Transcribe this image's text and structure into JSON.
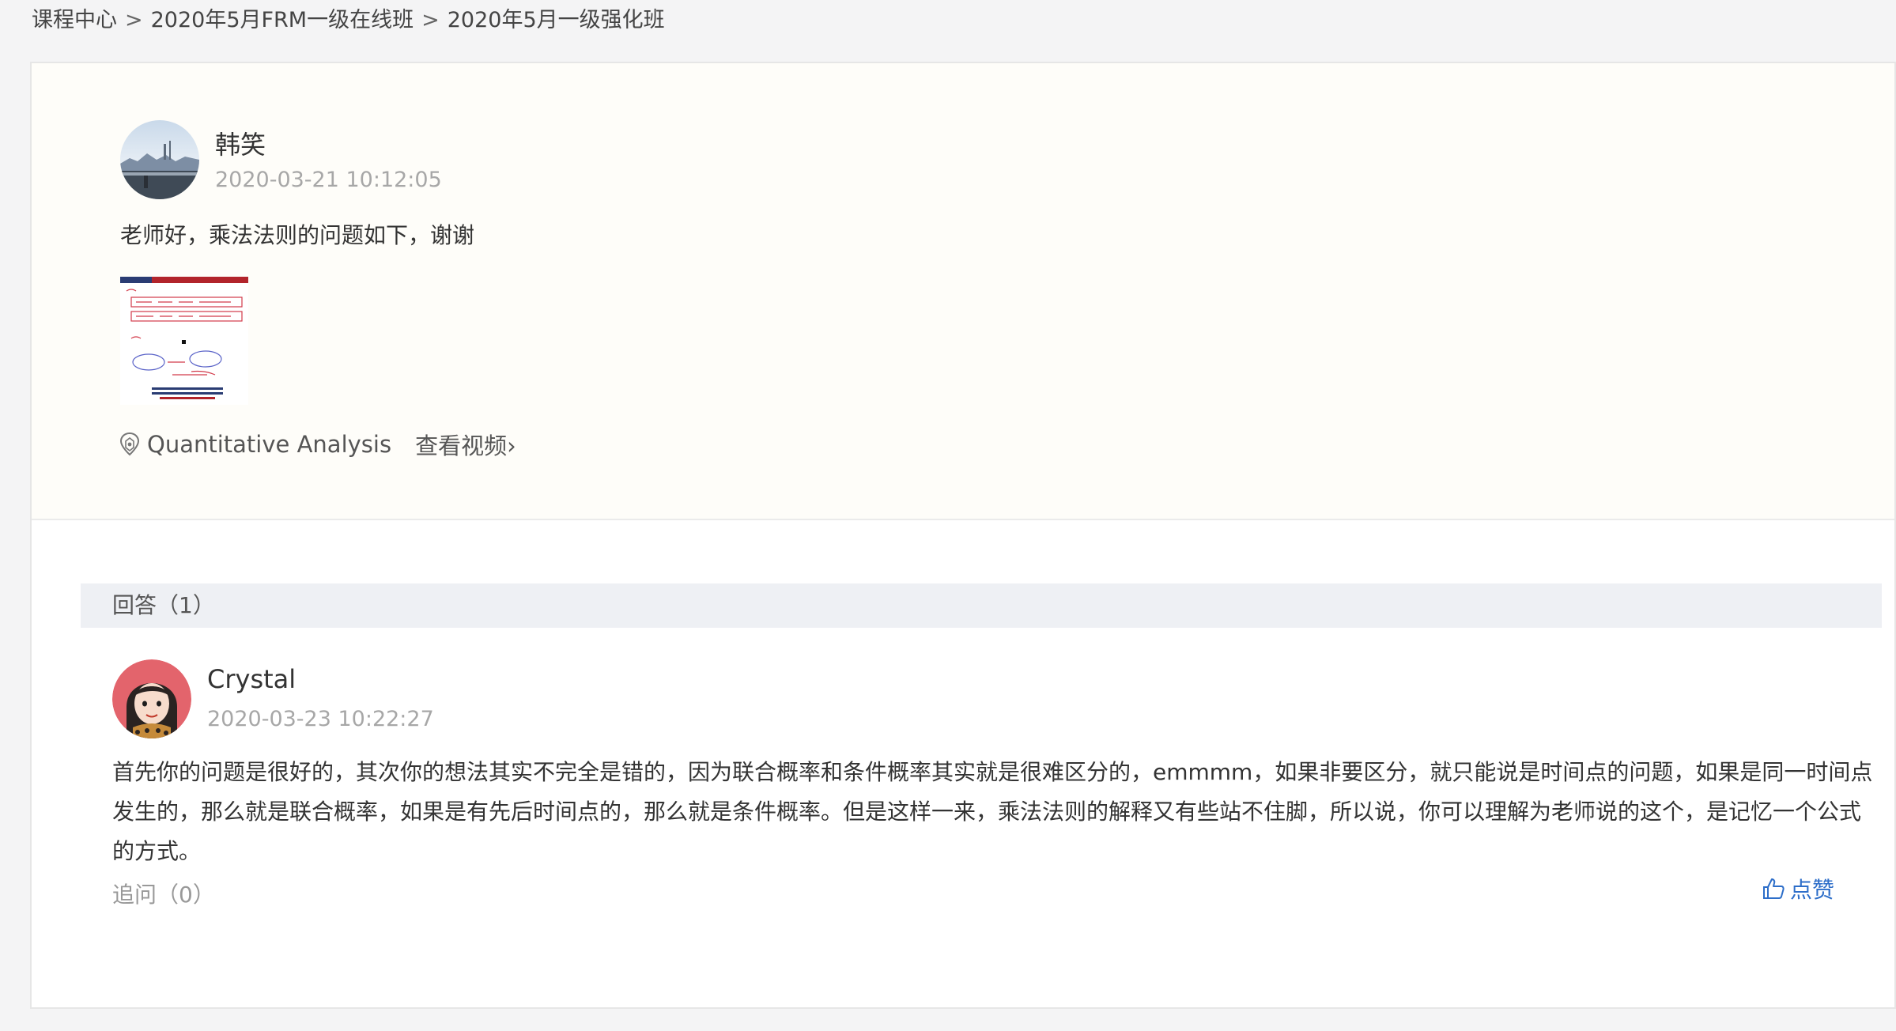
{
  "breadcrumb": {
    "items": [
      "课程中心",
      "2020年5月FRM一级在线班",
      "2020年5月一级强化班"
    ],
    "separator": ">"
  },
  "question": {
    "author": "韩笑",
    "time": "2020-03-21 10:12:05",
    "content": "老师好，乘法法则的问题如下，谢谢",
    "tag": "Quantitative Analysis",
    "video_link": "查看视频›",
    "attachment_icon": "formula-screenshot-thumbnail"
  },
  "answers": {
    "header": "回答（1）",
    "items": [
      {
        "author": "Crystal",
        "time": "2020-03-23 10:22:27",
        "content": "首先你的问题是很好的，其次你的想法其实不完全是错的，因为联合概率和条件概率其实就是很难区分的，emmmm，如果非要区分，就只能说是时间点的问题，如果是同一时间点发生的，那么就是联合概率，如果是有先后时间点的，那么就是条件概率。但是这样一来，乘法法则的解释又有些站不住脚，所以说，你可以理解为老师说的这个，是记忆一个公式的方式。",
        "followup": "追问（0）",
        "like": "点赞"
      }
    ]
  },
  "colors": {
    "accent": "#2d6ec9",
    "muted": "#a7a7a7",
    "question_bg": "#fefdf9",
    "answers_header_bg": "#eef0f4"
  },
  "icons": {
    "tag": "location-tag-icon",
    "like": "thumbs-up-icon"
  }
}
